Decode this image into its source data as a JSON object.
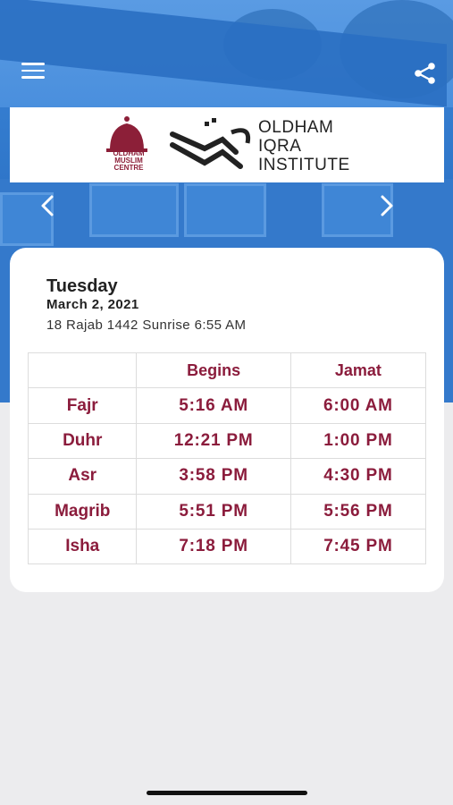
{
  "header": {
    "menu_icon": "hamburger-menu-icon",
    "share_icon": "share-icon"
  },
  "banner": {
    "logo_left_text": [
      "OLDHAM",
      "MUSLIM",
      "CENTRE"
    ],
    "logo_right_text": [
      "OLDHAM",
      "IQRA",
      "INSTITUTE"
    ]
  },
  "navigation": {
    "prev_icon": "chevron-left-icon",
    "next_icon": "chevron-right-icon"
  },
  "day_info": {
    "weekday": "Tuesday",
    "date": "March 2, 2021",
    "hijri_sunrise": "18 Rajab 1442 Sunrise 6:55 AM"
  },
  "table": {
    "headers": [
      "",
      "Begins",
      "Jamat"
    ],
    "rows": [
      {
        "prayer": "Fajr",
        "begins": "5:16 AM",
        "jamat": "6:00 AM"
      },
      {
        "prayer": "Duhr",
        "begins": "12:21 PM",
        "jamat": "1:00 PM"
      },
      {
        "prayer": "Asr",
        "begins": "3:58 PM",
        "jamat": "4:30 PM"
      },
      {
        "prayer": "Magrib",
        "begins": "5:51 PM",
        "jamat": "5:56 PM"
      },
      {
        "prayer": "Isha",
        "begins": "7:18 PM",
        "jamat": "7:45 PM"
      }
    ]
  },
  "colors": {
    "accent": "#8b1c3c",
    "hero_blue": "#3479cb"
  }
}
